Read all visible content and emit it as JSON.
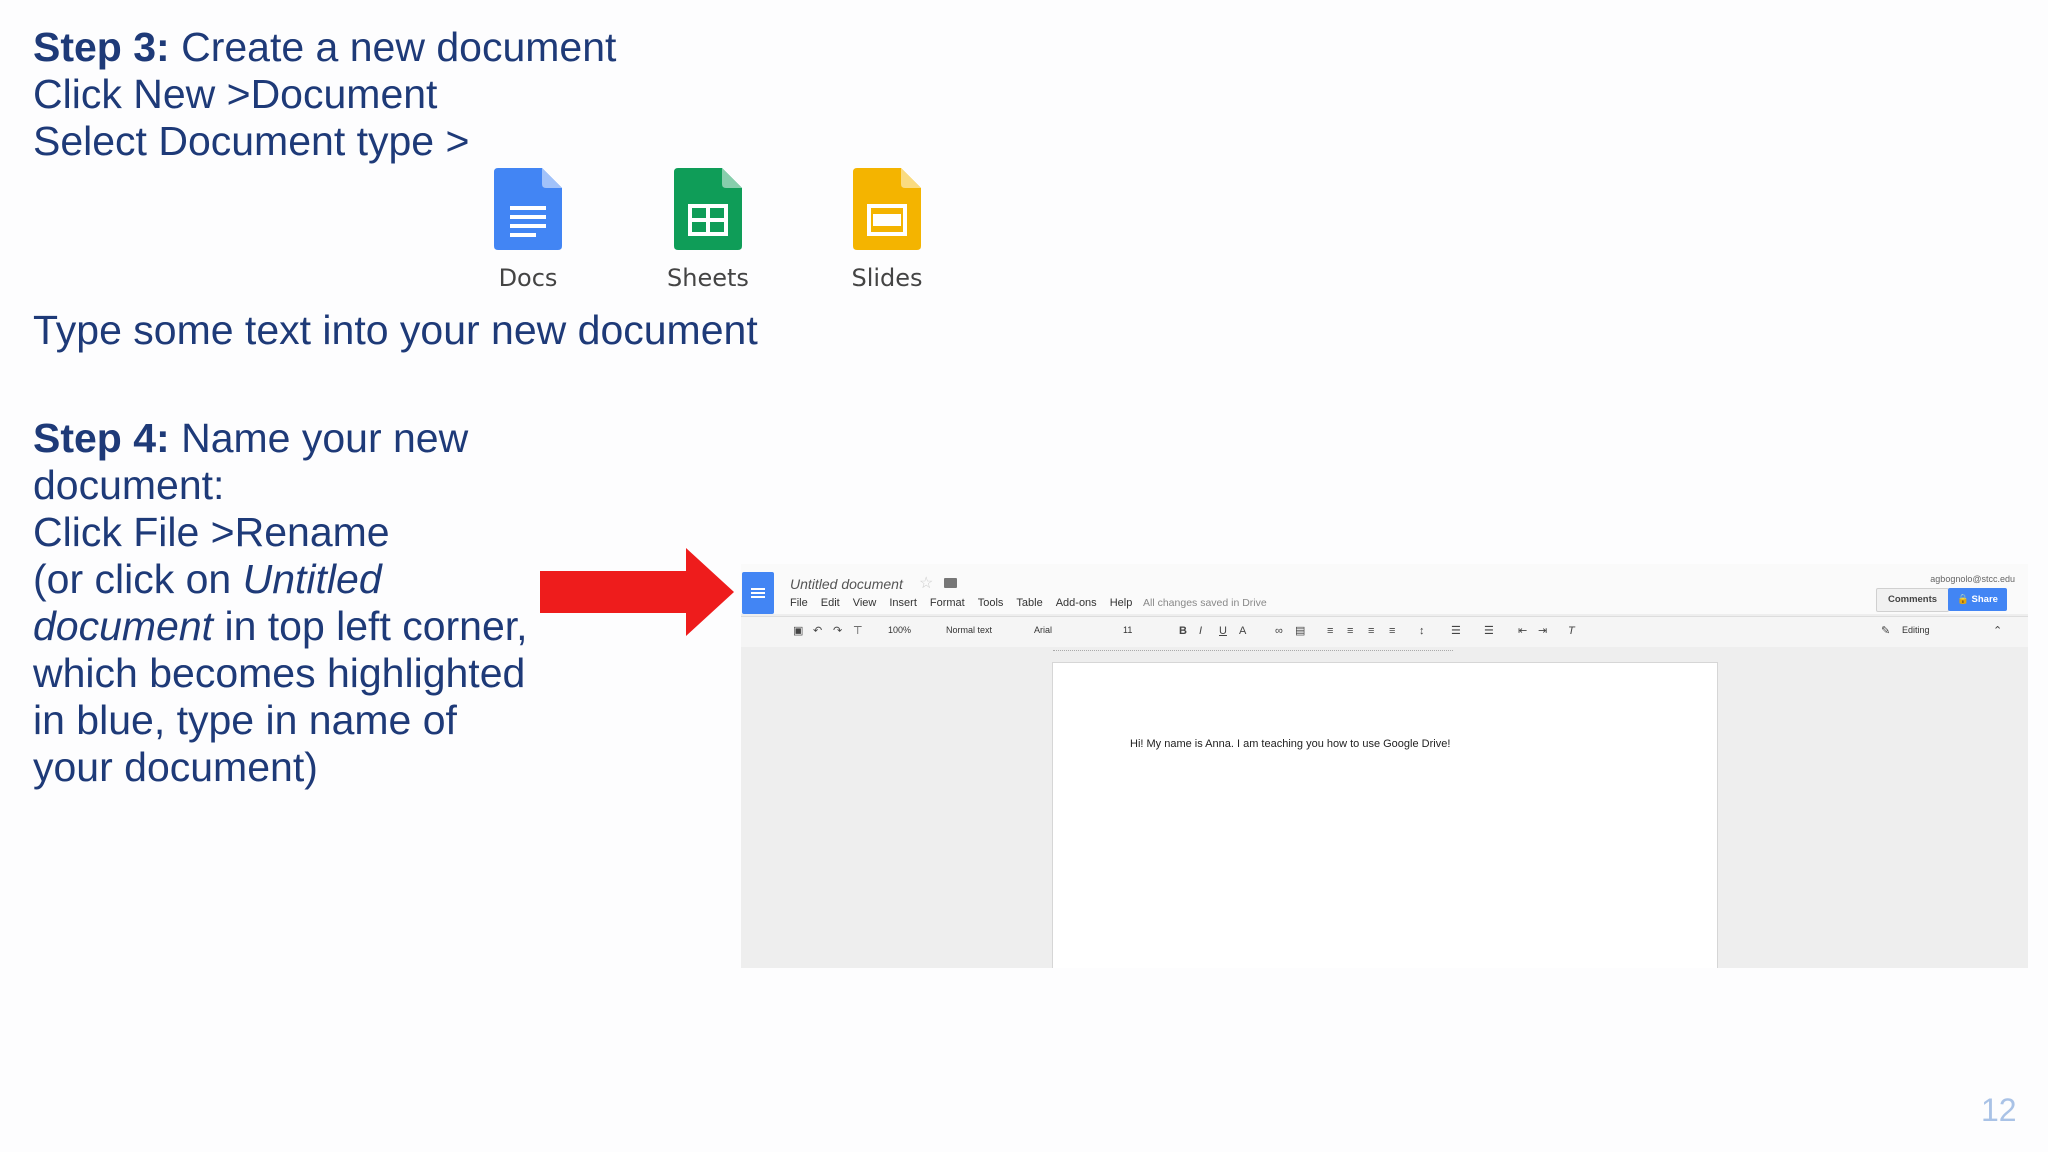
{
  "step3": {
    "label": "Step 3:",
    "title": " Create a new document",
    "line2": "Click New >Document",
    "line3": "Select Document type >"
  },
  "apps": [
    {
      "label": "Docs",
      "icon": "google-docs-icon",
      "color": "#4285f4"
    },
    {
      "label": "Sheets",
      "icon": "google-sheets-icon",
      "color": "#0f9d58"
    },
    {
      "label": "Slides",
      "icon": "google-slides-icon",
      "color": "#f4b400"
    }
  ],
  "type_text": "Type some text into your new document",
  "step4": {
    "label": "Step 4:",
    "line1": " Name your new document:",
    "line2": "Click File >Rename",
    "line3_a": "(or click on ",
    "line3_italic": "Untitled document",
    "line3_b": " in top left corner, which becomes highlighted in blue, type in name of your document)"
  },
  "arrow_color": "#ee1c1c",
  "gdoc": {
    "title": "Untitled document",
    "menu": [
      "File",
      "Edit",
      "View",
      "Insert",
      "Format",
      "Tools",
      "Table",
      "Add-ons",
      "Help"
    ],
    "saved_status": "All changes saved in Drive",
    "account": "agbognolo@stcc.edu",
    "comments_label": "Comments",
    "share_label": "Share",
    "zoom": "100%",
    "style": "Normal text",
    "font": "Arial",
    "font_size": "11",
    "mode": "Editing",
    "body_text": "Hi! My name is Anna. I am teaching you how to use Google Drive!"
  },
  "page_number": "12"
}
